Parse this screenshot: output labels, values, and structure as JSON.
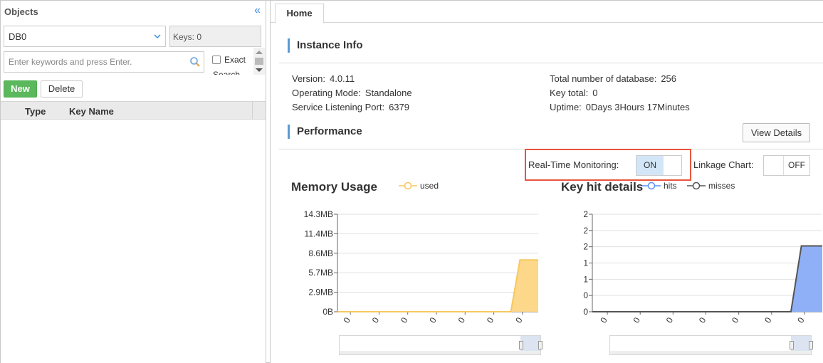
{
  "sidebar": {
    "title": "Objects",
    "db_select": {
      "value": "DB0"
    },
    "keys_label": "Keys: 0",
    "search": {
      "placeholder": "Enter keywords and press Enter.",
      "value": ""
    },
    "exact_label": "Exact",
    "clipped_label": "Search",
    "new_button": "New",
    "delete_button": "Delete",
    "table_columns": [
      "Type",
      "Key Name"
    ]
  },
  "tabs": [
    {
      "label": "Home",
      "active": true
    }
  ],
  "instance_info": {
    "title": "Instance Info",
    "version": {
      "label": "Version:",
      "value": "4.0.11"
    },
    "operating_mode": {
      "label": "Operating Mode:",
      "value": "Standalone"
    },
    "port": {
      "label": "Service Listening Port:",
      "value": "6379"
    },
    "total_db": {
      "label": "Total number of database:",
      "value": "256"
    },
    "key_total": {
      "label": "Key total:",
      "value": "0"
    },
    "uptime": {
      "label": "Uptime:",
      "value": "0Days 3Hours 17Minutes"
    }
  },
  "performance": {
    "title": "Performance",
    "view_details_button": "View Details",
    "realtime": {
      "label": "Real-Time Monitoring:",
      "state": "ON"
    },
    "linkage": {
      "label": "Linkage Chart:",
      "state": "OFF"
    }
  },
  "colors": {
    "memory_series": "#f6c85f",
    "memory_fill": "#fdd88a",
    "hits_series": "#5b8ff9",
    "hits_fill": "#8fb0f7",
    "misses_series": "#555555",
    "accent_green": "#5cb85c",
    "highlight_red": "#e8553e",
    "section_bar": "#5b9bd5"
  },
  "icons": {
    "collapse": "double-chevron-left-icon",
    "dropdown": "chevron-down-icon",
    "search": "search-icon"
  },
  "chart_data": [
    {
      "type": "area",
      "title": "Memory Usage",
      "series": [
        {
          "name": "used",
          "values": [
            0,
            0,
            0,
            0,
            0,
            0,
            0,
            0,
            0,
            0,
            0,
            0,
            0,
            0,
            0,
            0,
            0,
            0,
            0,
            0,
            7.6,
            7.6,
            7.6
          ]
        }
      ],
      "y_ticks": [
        "0B",
        "2.9MB",
        "5.7MB",
        "8.6MB",
        "11.4MB",
        "14.3MB"
      ],
      "ylim": [
        0,
        14.3
      ],
      "x_tick_labels": [
        "0",
        "0",
        "0",
        "0",
        "0",
        "0",
        "0"
      ],
      "legend_position": "top",
      "grid": true
    },
    {
      "type": "area",
      "title": "Key hit details",
      "series": [
        {
          "name": "hits",
          "values": [
            0,
            0,
            0,
            0,
            0,
            0,
            0,
            0,
            0,
            0,
            0,
            0,
            0,
            0,
            0,
            0,
            0,
            0,
            0,
            0,
            1.35,
            1.35,
            1.35
          ]
        },
        {
          "name": "misses",
          "values": [
            0,
            0,
            0,
            0,
            0,
            0,
            0,
            0,
            0,
            0,
            0,
            0,
            0,
            0,
            0,
            0,
            0,
            0,
            0,
            0,
            1.35,
            1.35,
            1.35
          ]
        }
      ],
      "y_ticks": [
        "0",
        "0",
        "1",
        "1",
        "2",
        "2",
        "2"
      ],
      "ylim": [
        0,
        2
      ],
      "x_tick_labels": [
        "0",
        "0",
        "0",
        "0",
        "0",
        "0",
        "0"
      ],
      "legend_position": "top",
      "grid": true
    }
  ]
}
